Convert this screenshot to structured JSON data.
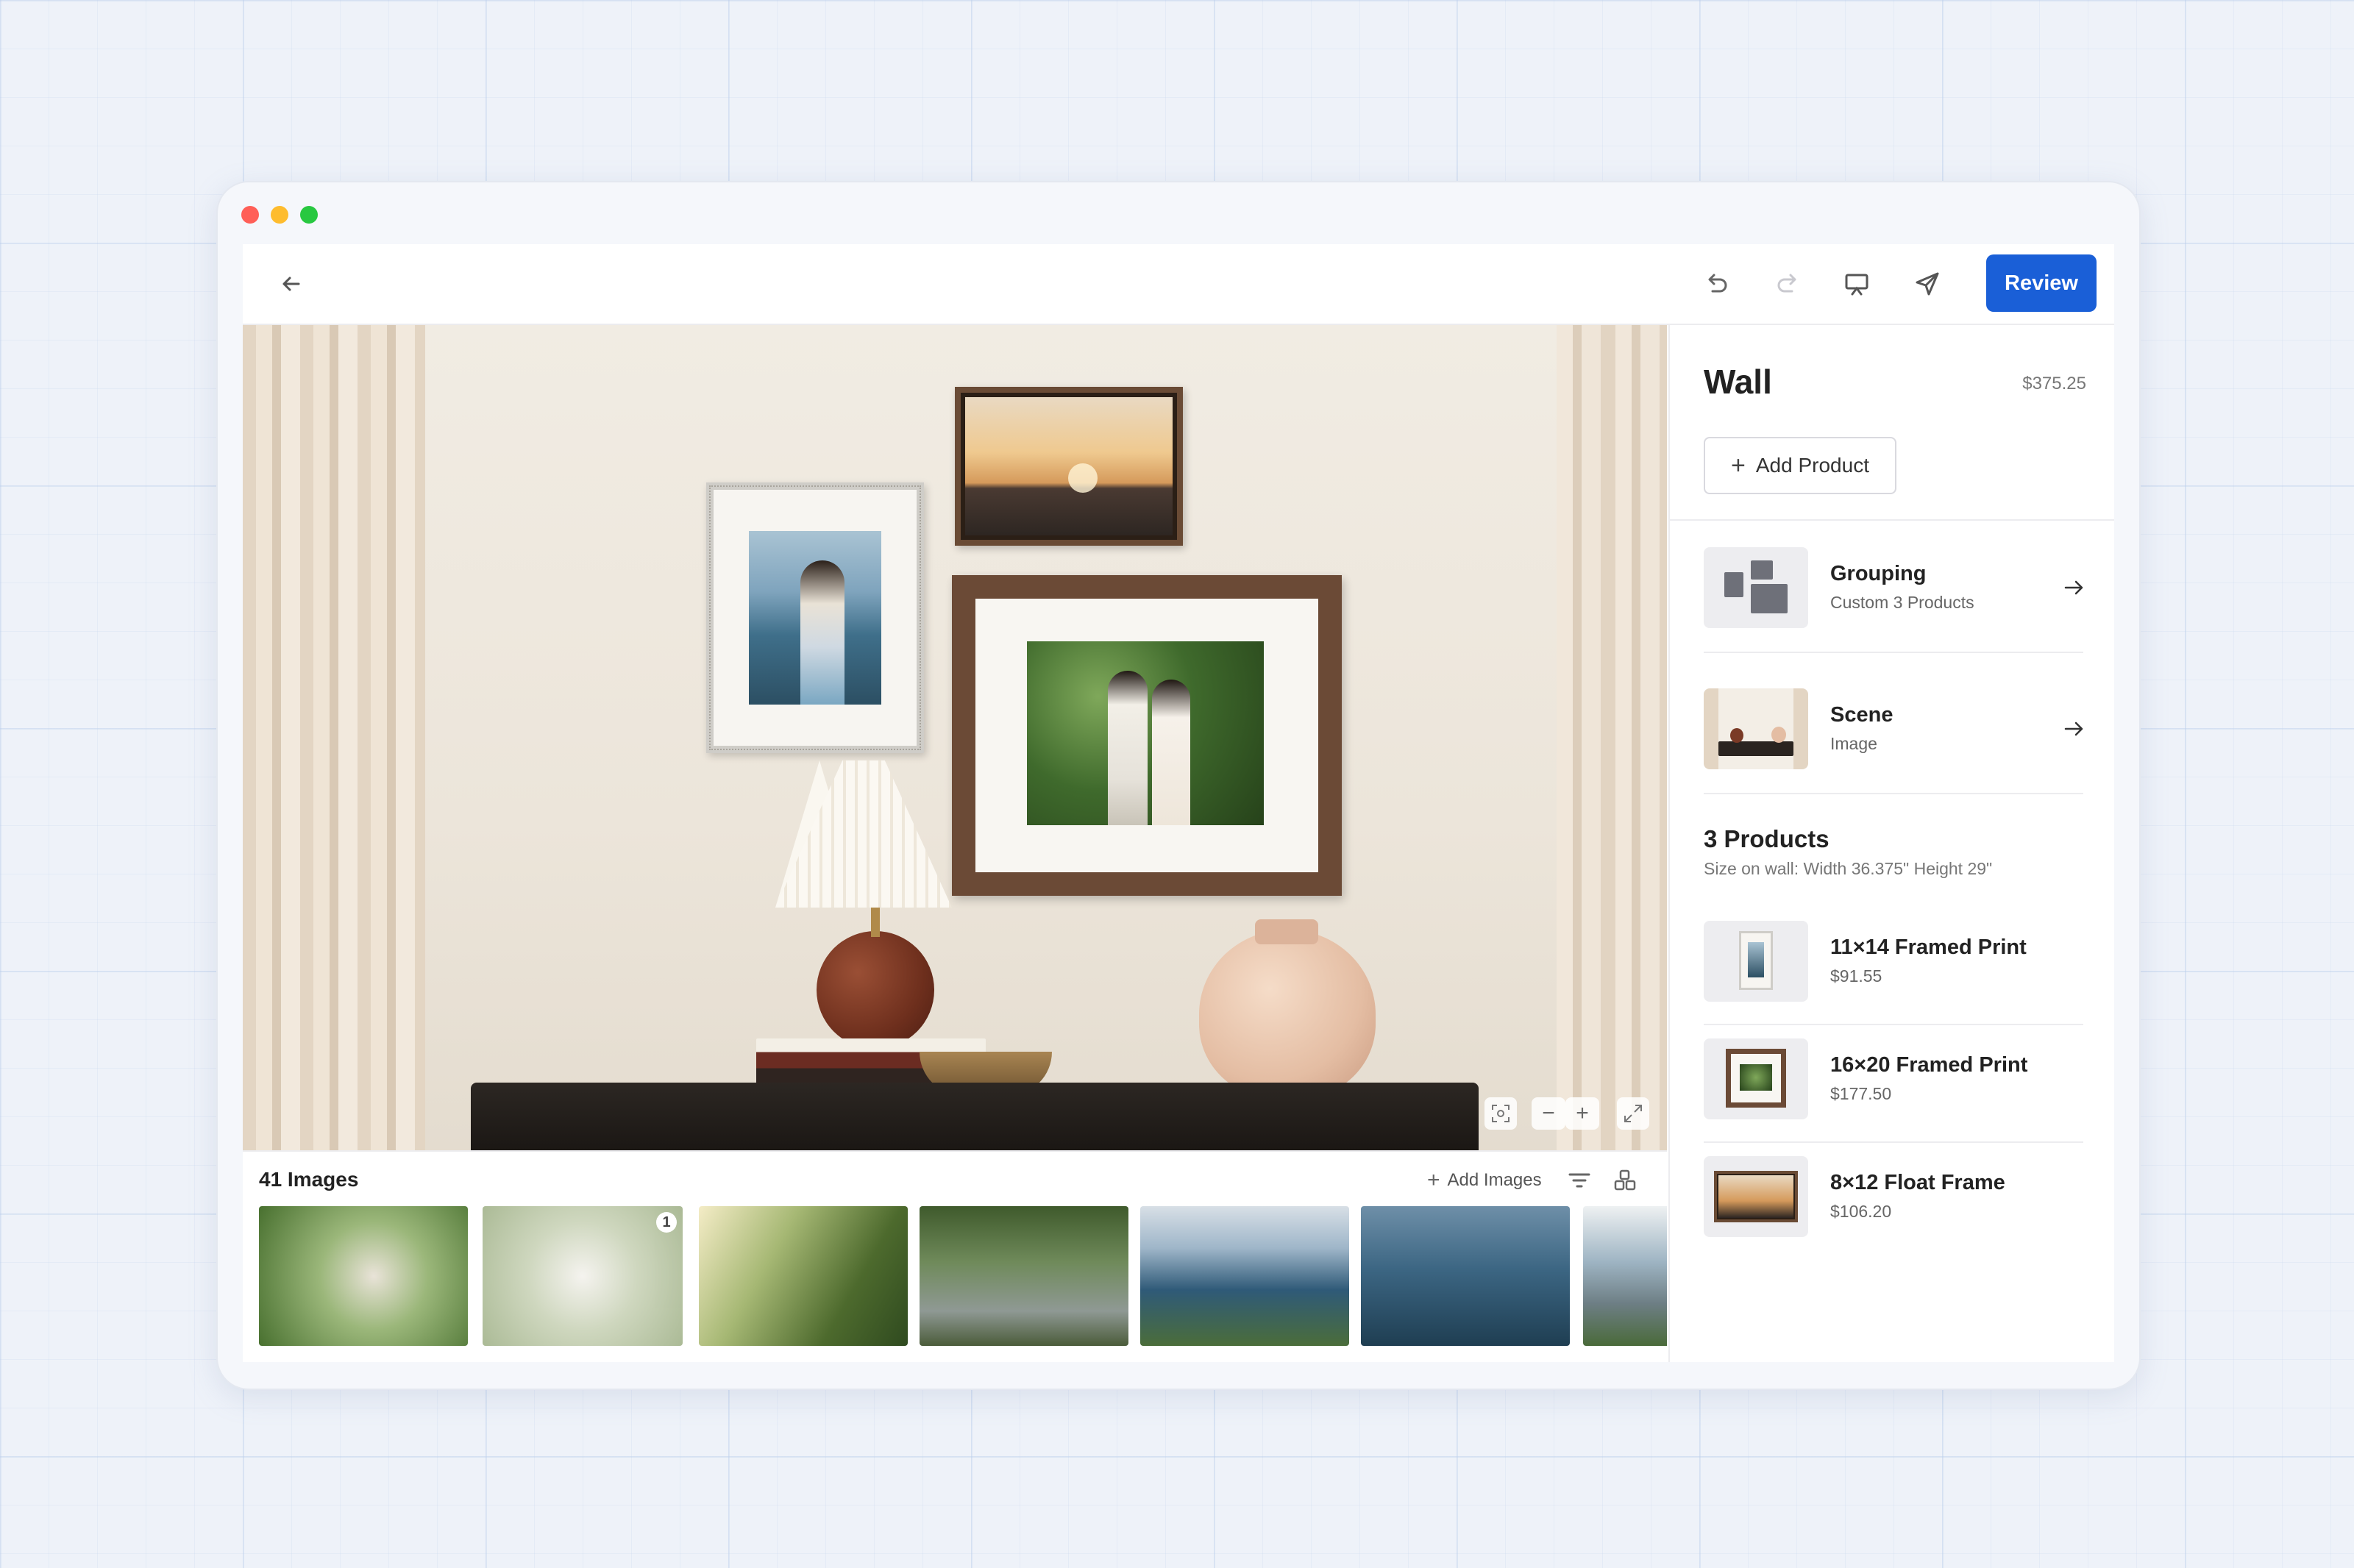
{
  "toolbar": {
    "review_label": "Review",
    "icons": [
      "back-arrow-icon",
      "undo-icon",
      "redo-icon",
      "presentation-icon",
      "send-icon"
    ]
  },
  "canvas": {
    "zoom_controls": [
      "focus-icon",
      "zoom-out-icon",
      "zoom-in-icon",
      "expand-icon"
    ]
  },
  "strip": {
    "title": "41 Images",
    "add_images_label": "Add Images",
    "thumbnails": [
      {
        "badge": ""
      },
      {
        "badge": "1"
      },
      {
        "badge": ""
      },
      {
        "badge": ""
      },
      {
        "badge": ""
      },
      {
        "badge": ""
      },
      {
        "badge": ""
      }
    ]
  },
  "panel": {
    "title": "Wall",
    "price": "$375.25",
    "add_product_label": "Add Product",
    "grouping": {
      "title": "Grouping",
      "subtitle": "Custom 3 Products"
    },
    "scene": {
      "title": "Scene",
      "subtitle": "Image"
    },
    "products_heading": "3 Products",
    "size_on_wall": "Size on wall: Width 36.375\" Height 29\"",
    "products": [
      {
        "name": "11×14 Framed Print",
        "price": "$91.55"
      },
      {
        "name": "16×20 Framed Print",
        "price": "$177.50"
      },
      {
        "name": "8×12 Float Frame",
        "price": "$106.20"
      }
    ]
  },
  "colors": {
    "accent": "#1a5fd7",
    "close": "#ff5f57",
    "minimize": "#febc2e",
    "maximize": "#28c840"
  }
}
